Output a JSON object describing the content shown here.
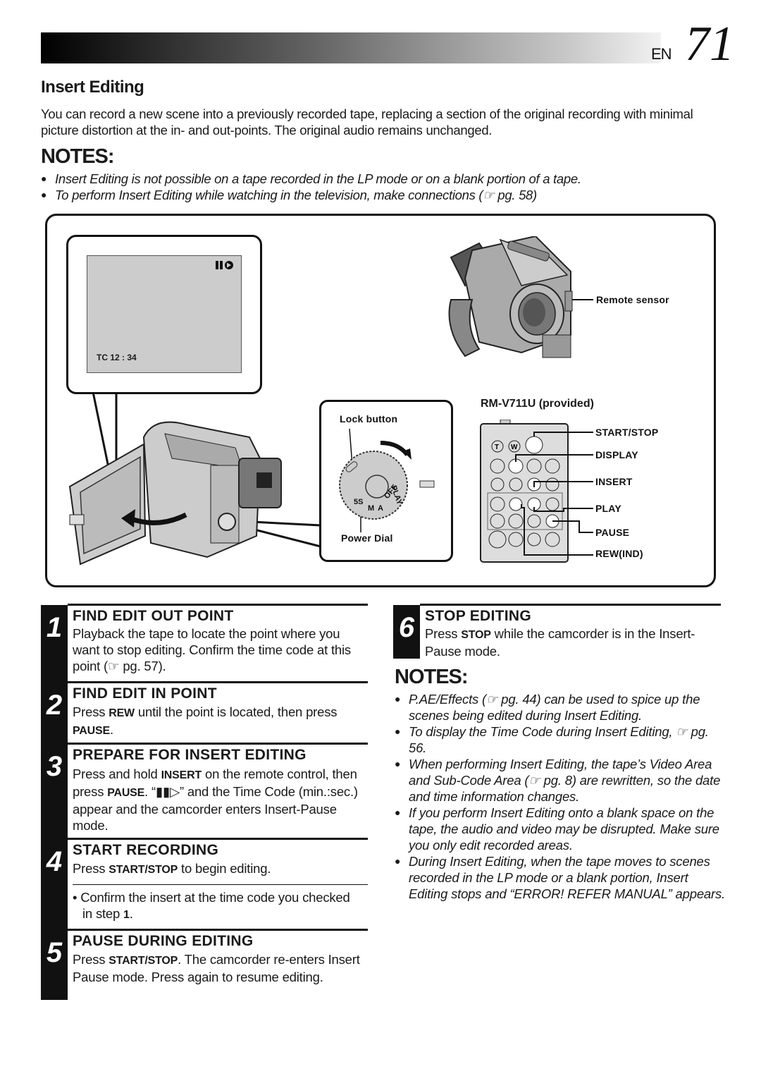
{
  "header": {
    "lang": "EN",
    "page_number": "71"
  },
  "section": {
    "title": "Insert Editing",
    "intro": "You can record a new scene into a previously recorded tape, replacing a section of the original recording with minimal picture distortion at the in- and out-points. The original audio remains unchanged."
  },
  "notes_top": {
    "heading": "NOTES:",
    "items": [
      "Insert Editing is not possible on a tape recorded in the LP mode or on a blank portion of a tape.",
      "To perform Insert Editing while watching in the television, make connections (☞ pg. 58)"
    ]
  },
  "diagram": {
    "lcd": {
      "timecode": "TC  12 : 34",
      "status_icon": "insert-pause-icon"
    },
    "labels": {
      "remote_sensor": "Remote sensor",
      "lock_button": "Lock button",
      "power_dial": "Power Dial"
    },
    "dial_marks": [
      "PLAY",
      "OFF",
      "A",
      "M",
      "5S"
    ],
    "remote": {
      "title": "RM-V711U (provided)",
      "buttons": [
        "START/STOP",
        "DISPLAY",
        "INSERT",
        "PLAY",
        "PAUSE",
        "REW(IND)"
      ],
      "zoom_keys": [
        "T",
        "W"
      ]
    }
  },
  "steps": [
    {
      "num": "1",
      "title": "FIND EDIT OUT POINT",
      "body": "Playback the tape to locate the point where you want to stop editing. Confirm the time code at this point (☞ pg. 57)."
    },
    {
      "num": "2",
      "title": "FIND EDIT IN POINT",
      "body_pre": "Press ",
      "key1": "REW",
      "body_mid": "  until the point is located, then press ",
      "key2": "PAUSE",
      "body_post": "."
    },
    {
      "num": "3",
      "title": "PREPARE FOR INSERT EDITING",
      "body_pre": "Press and hold ",
      "key1": "INSERT",
      "body_mid": " on the remote control, then press ",
      "key2": "PAUSE",
      "body_post": ". “▮▮▷” and the Time Code (min.:sec.) appear and the camcorder enters Insert-Pause mode."
    },
    {
      "num": "4",
      "title": "START RECORDING",
      "body_pre": "Press ",
      "key1": "START/STOP",
      "body_post": " to begin editing.",
      "sub_note_pre": "• Confirm the insert at the time code you checked in step ",
      "sub_note_key": "1",
      "sub_note_post": "."
    },
    {
      "num": "5",
      "title": "PAUSE DURING EDITING",
      "body_pre": "Press ",
      "key1": "START/STOP",
      "body_post": ". The camcorder re-enters Insert Pause mode. Press again to resume editing."
    },
    {
      "num": "6",
      "title": "STOP EDITING",
      "body_pre": "Press ",
      "key1": "STOP",
      "body_post": " while the camcorder is in the Insert-Pause mode."
    }
  ],
  "notes_right": {
    "heading": "NOTES:",
    "items": [
      "P.AE/Effects (☞ pg. 44) can be used to spice up the scenes being edited during Insert Editing.",
      "To display the Time Code during Insert Editing, ☞ pg. 56.",
      "When performing Insert Editing, the tape’s Video Area and Sub-Code Area (☞ pg. 8) are rewritten, so the date and time information changes.",
      "If you perform Insert Editing onto a blank space on the tape, the audio and video may be disrupted. Make sure you only edit recorded areas.",
      "During Insert Editing, when the tape moves to scenes recorded in the LP mode or a blank portion, Insert Editing stops and “ERROR! REFER MANUAL” appears."
    ]
  }
}
